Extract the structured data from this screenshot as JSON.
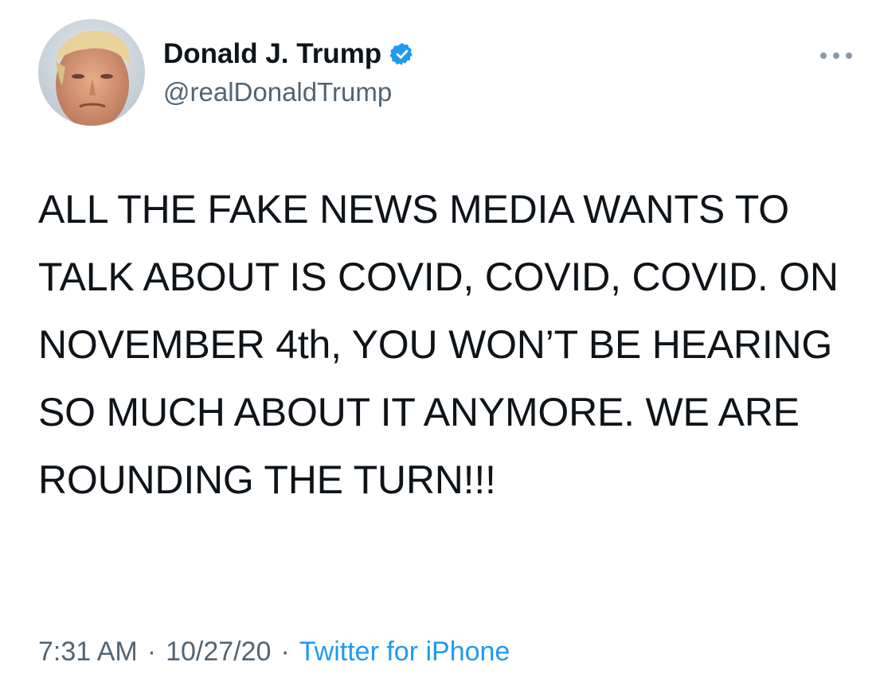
{
  "author": {
    "display_name": "Donald J. Trump",
    "handle": "@realDonaldTrump",
    "verified": true,
    "avatar_icon": "profile-photo"
  },
  "menu": {
    "icon": "more-options-icon"
  },
  "tweet": {
    "text": "ALL THE FAKE NEWS MEDIA WANTS TO TALK ABOUT IS COVID, COVID, COVID. ON NOVEMBER 4th, YOU WON’T BE HEARING SO MUCH ABOUT IT ANYMORE. WE ARE ROUNDING THE TURN!!!"
  },
  "meta": {
    "time": "7:31 AM",
    "date": "10/27/20",
    "separator": "·",
    "source": "Twitter for iPhone"
  },
  "colors": {
    "text": "#0f1419",
    "secondary": "#536471",
    "accent": "#1d9bf0"
  }
}
